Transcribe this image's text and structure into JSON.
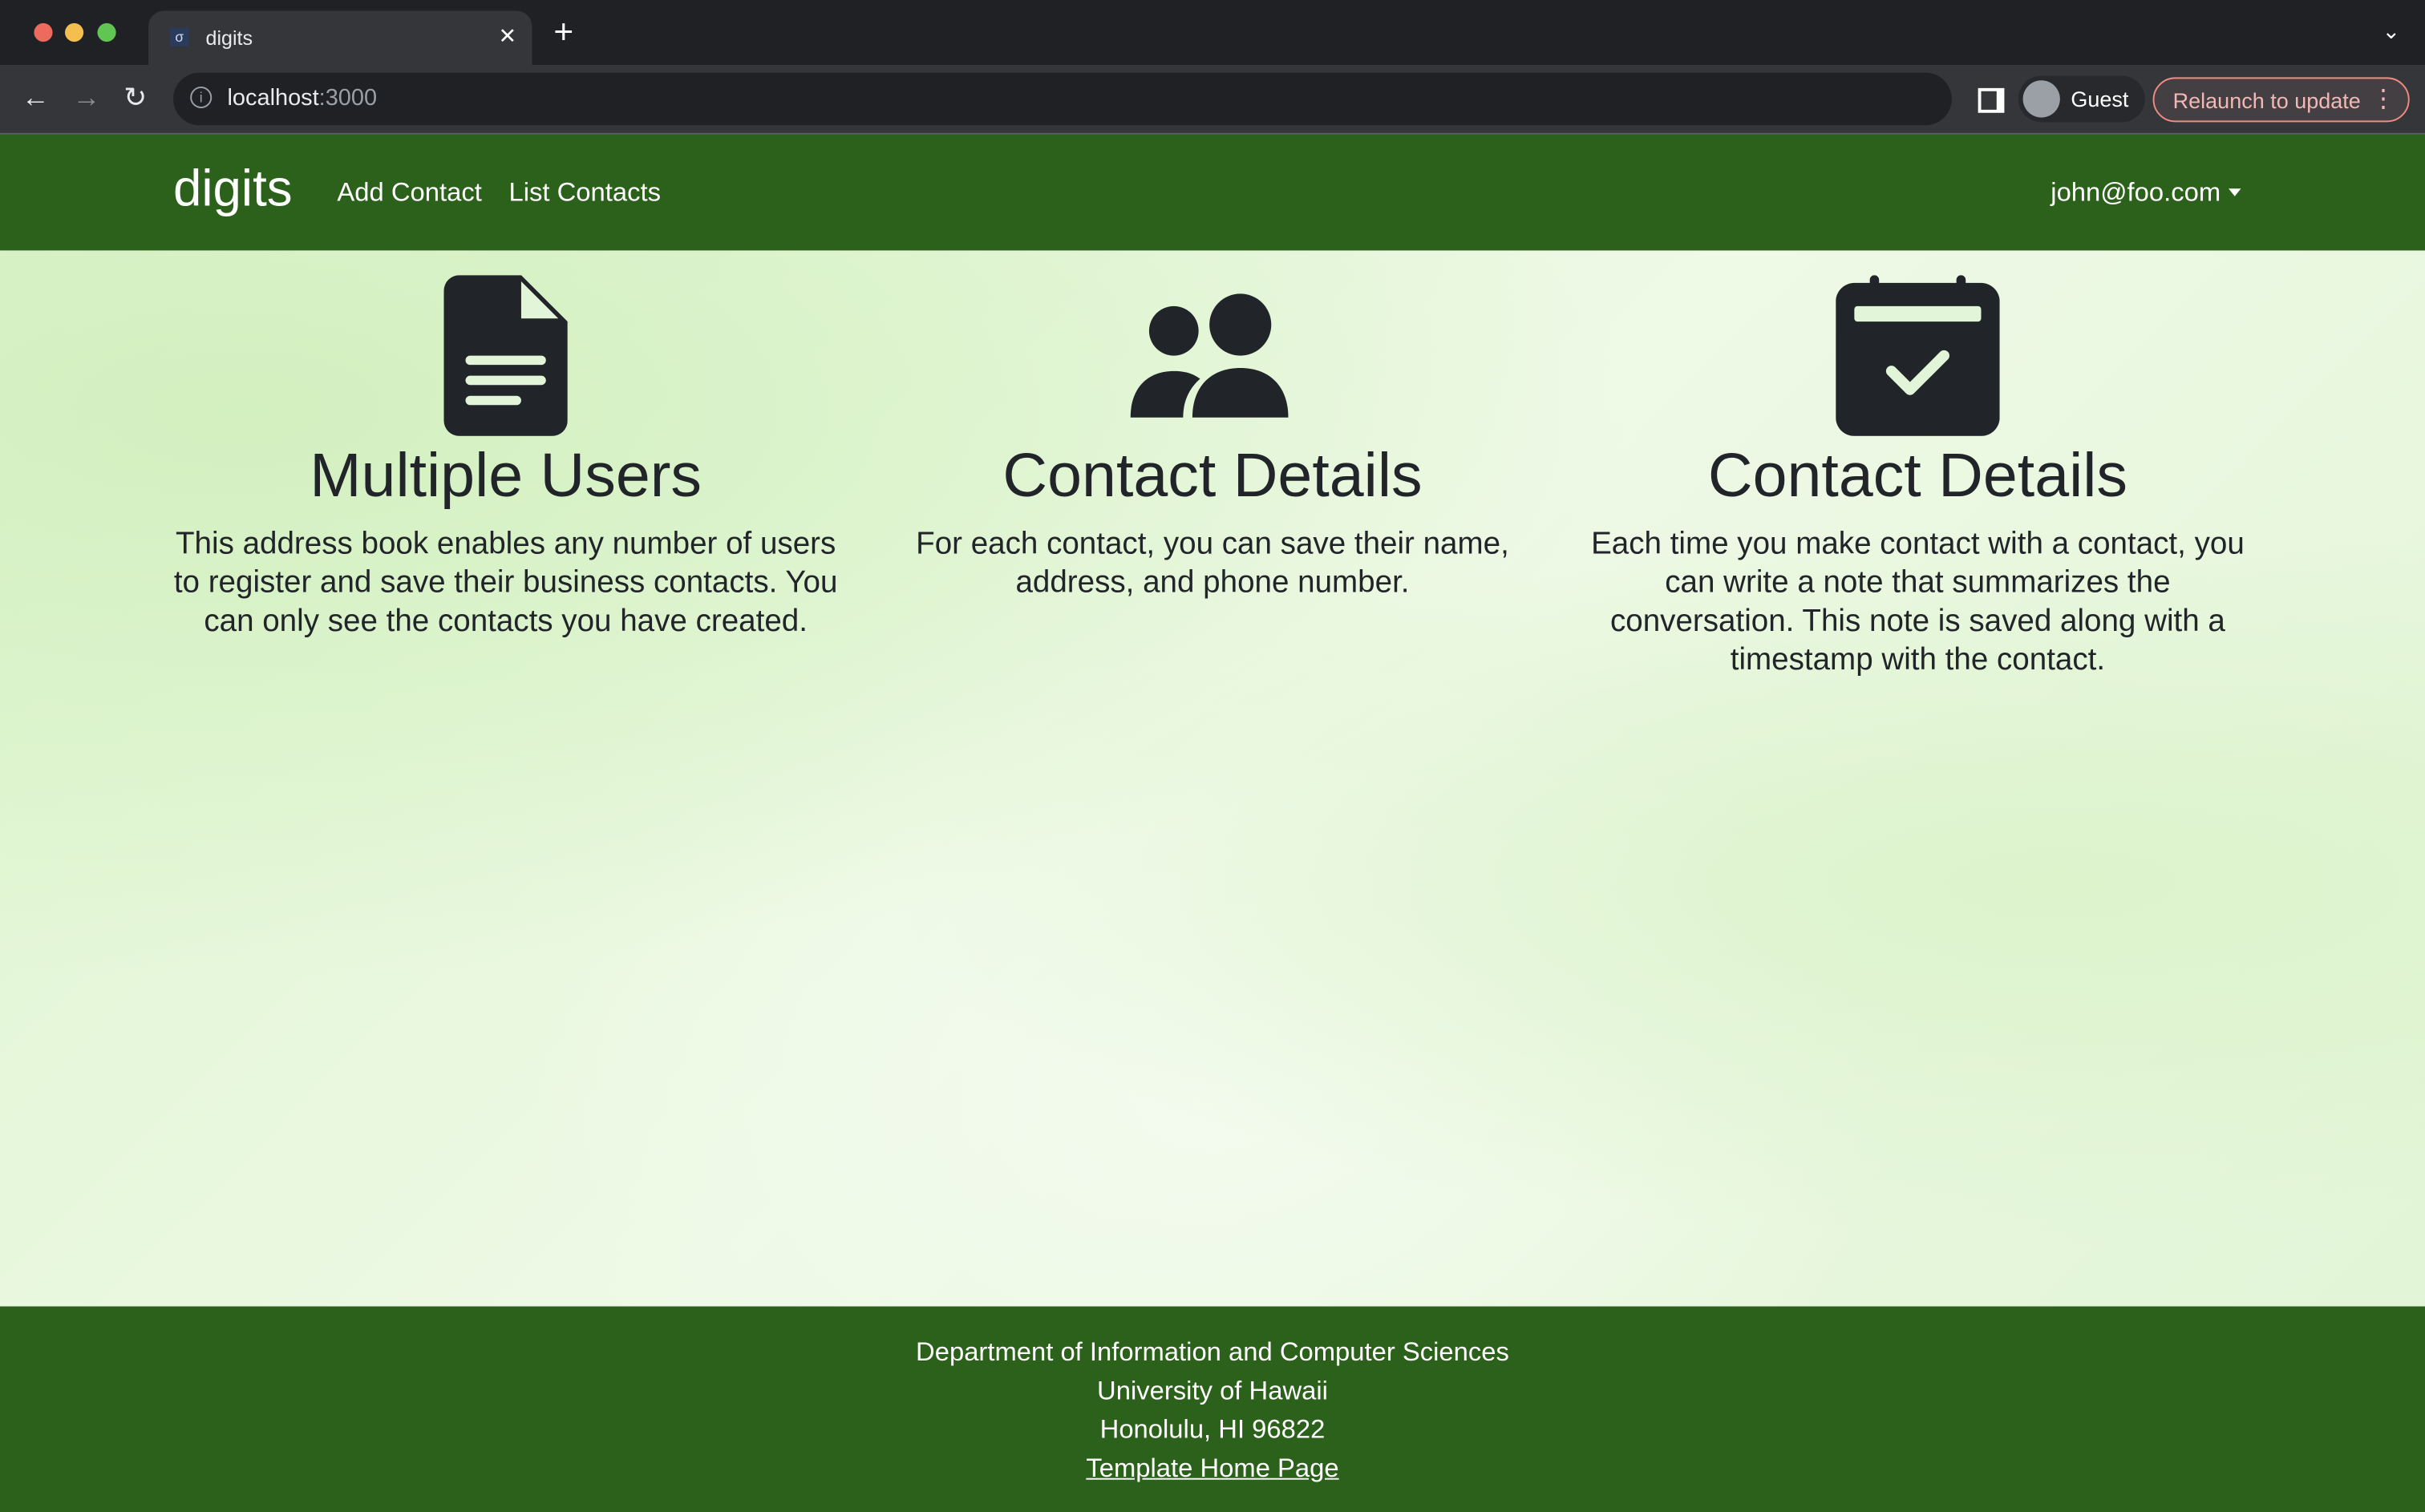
{
  "browser": {
    "tab_title": "digits",
    "url_host": "localhost",
    "url_port": ":3000",
    "profile": "Guest",
    "relaunch_label": "Relaunch to update"
  },
  "navbar": {
    "brand": "digits",
    "links": [
      "Add Contact",
      "List Contacts"
    ],
    "user": "john@foo.com"
  },
  "features": [
    {
      "icon": "file-icon",
      "title": "Multiple Users",
      "text": "This address book enables any number of users to register and save their business contacts. You can only see the contacts you have created."
    },
    {
      "icon": "users-icon",
      "title": "Contact Details",
      "text": "For each contact, you can save their name, address, and phone number."
    },
    {
      "icon": "calendar-check-icon",
      "title": "Contact Details",
      "text": "Each time you make contact with a contact, you can write a note that summarizes the conversation. This note is saved along with a timestamp with the contact."
    }
  ],
  "footer": {
    "lines": [
      "Department of Information and Computer Sciences",
      "University of Hawaii",
      "Honolulu, HI 96822"
    ],
    "link": "Template Home Page"
  },
  "colors": {
    "brand_green": "#2b611a"
  }
}
